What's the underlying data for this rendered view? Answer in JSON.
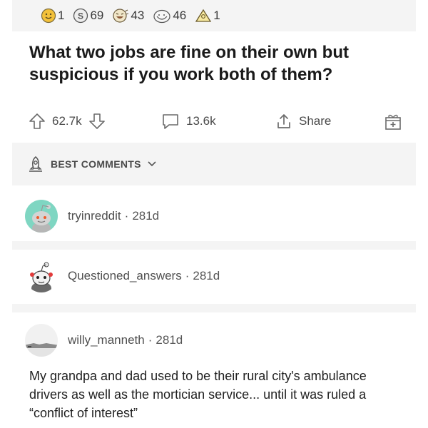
{
  "awards": [
    {
      "icon": "gold-smile-award-icon",
      "count": "1"
    },
    {
      "icon": "silver-coin-award-icon",
      "count": "69"
    },
    {
      "icon": "laughing-award-icon",
      "count": "43"
    },
    {
      "icon": "wholesome-award-icon",
      "count": "46"
    },
    {
      "icon": "pyramid-award-icon",
      "count": "1"
    }
  ],
  "post": {
    "title": "What two jobs are fine on their own but suspicious if you work both of them?"
  },
  "actions": {
    "upvotes": "62.7k",
    "comments": "13.6k",
    "share_label": "Share"
  },
  "sort": {
    "label": "BEST COMMENTS"
  },
  "comments": [
    {
      "author": "tryinreddit",
      "age": "281d",
      "body": ""
    },
    {
      "author": "Questioned_answers",
      "age": "281d",
      "body": ""
    },
    {
      "author": "willy_manneth",
      "age": "281d",
      "body": "My grandpa and dad used to be their rural city's ambulance drivers as well as the mortician service... until it was ruled a “conflict of interest”"
    }
  ],
  "colors": {
    "background": "#ffffff",
    "bar_background": "#f4f4f4",
    "text": "#1c1c1c",
    "muted_text": "#4a4a4a",
    "avatar_teal": "#7fd6c2"
  },
  "separator": "·"
}
